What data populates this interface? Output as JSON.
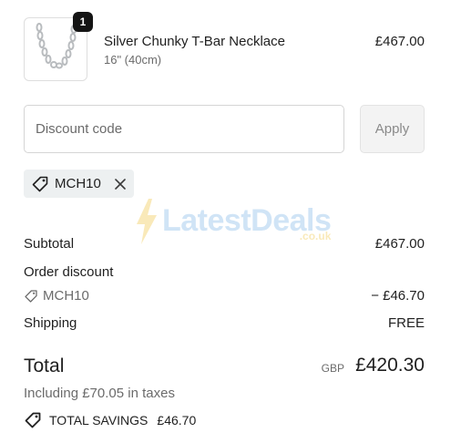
{
  "cart_item": {
    "quantity": "1",
    "name": "Silver Chunky T-Bar Necklace",
    "variant": "16\" (40cm)",
    "price": "£467.00"
  },
  "discount": {
    "placeholder": "Discount code",
    "apply_label": "Apply",
    "applied_code": "MCH10"
  },
  "watermark": {
    "brand": "LatestDeals",
    "domain": ".co.uk"
  },
  "summary": {
    "subtotal_label": "Subtotal",
    "subtotal_value": "£467.00",
    "order_discount_label": "Order discount",
    "order_discount_code": "MCH10",
    "order_discount_value": "− £46.70",
    "shipping_label": "Shipping",
    "shipping_value": "FREE",
    "total_label": "Total",
    "currency": "GBP",
    "total_value": "£420.30",
    "taxes_note": "Including £70.05 in taxes",
    "savings_label": "TOTAL SAVINGS",
    "savings_value": "£46.70"
  },
  "colors": {
    "badge": "#141414",
    "chip_bg": "#edf0f1",
    "apply_bg": "#f3f3f3",
    "muted_text": "#6b6b6b"
  },
  "icons": [
    "necklace-thumbnail",
    "tag-icon",
    "close-icon"
  ]
}
